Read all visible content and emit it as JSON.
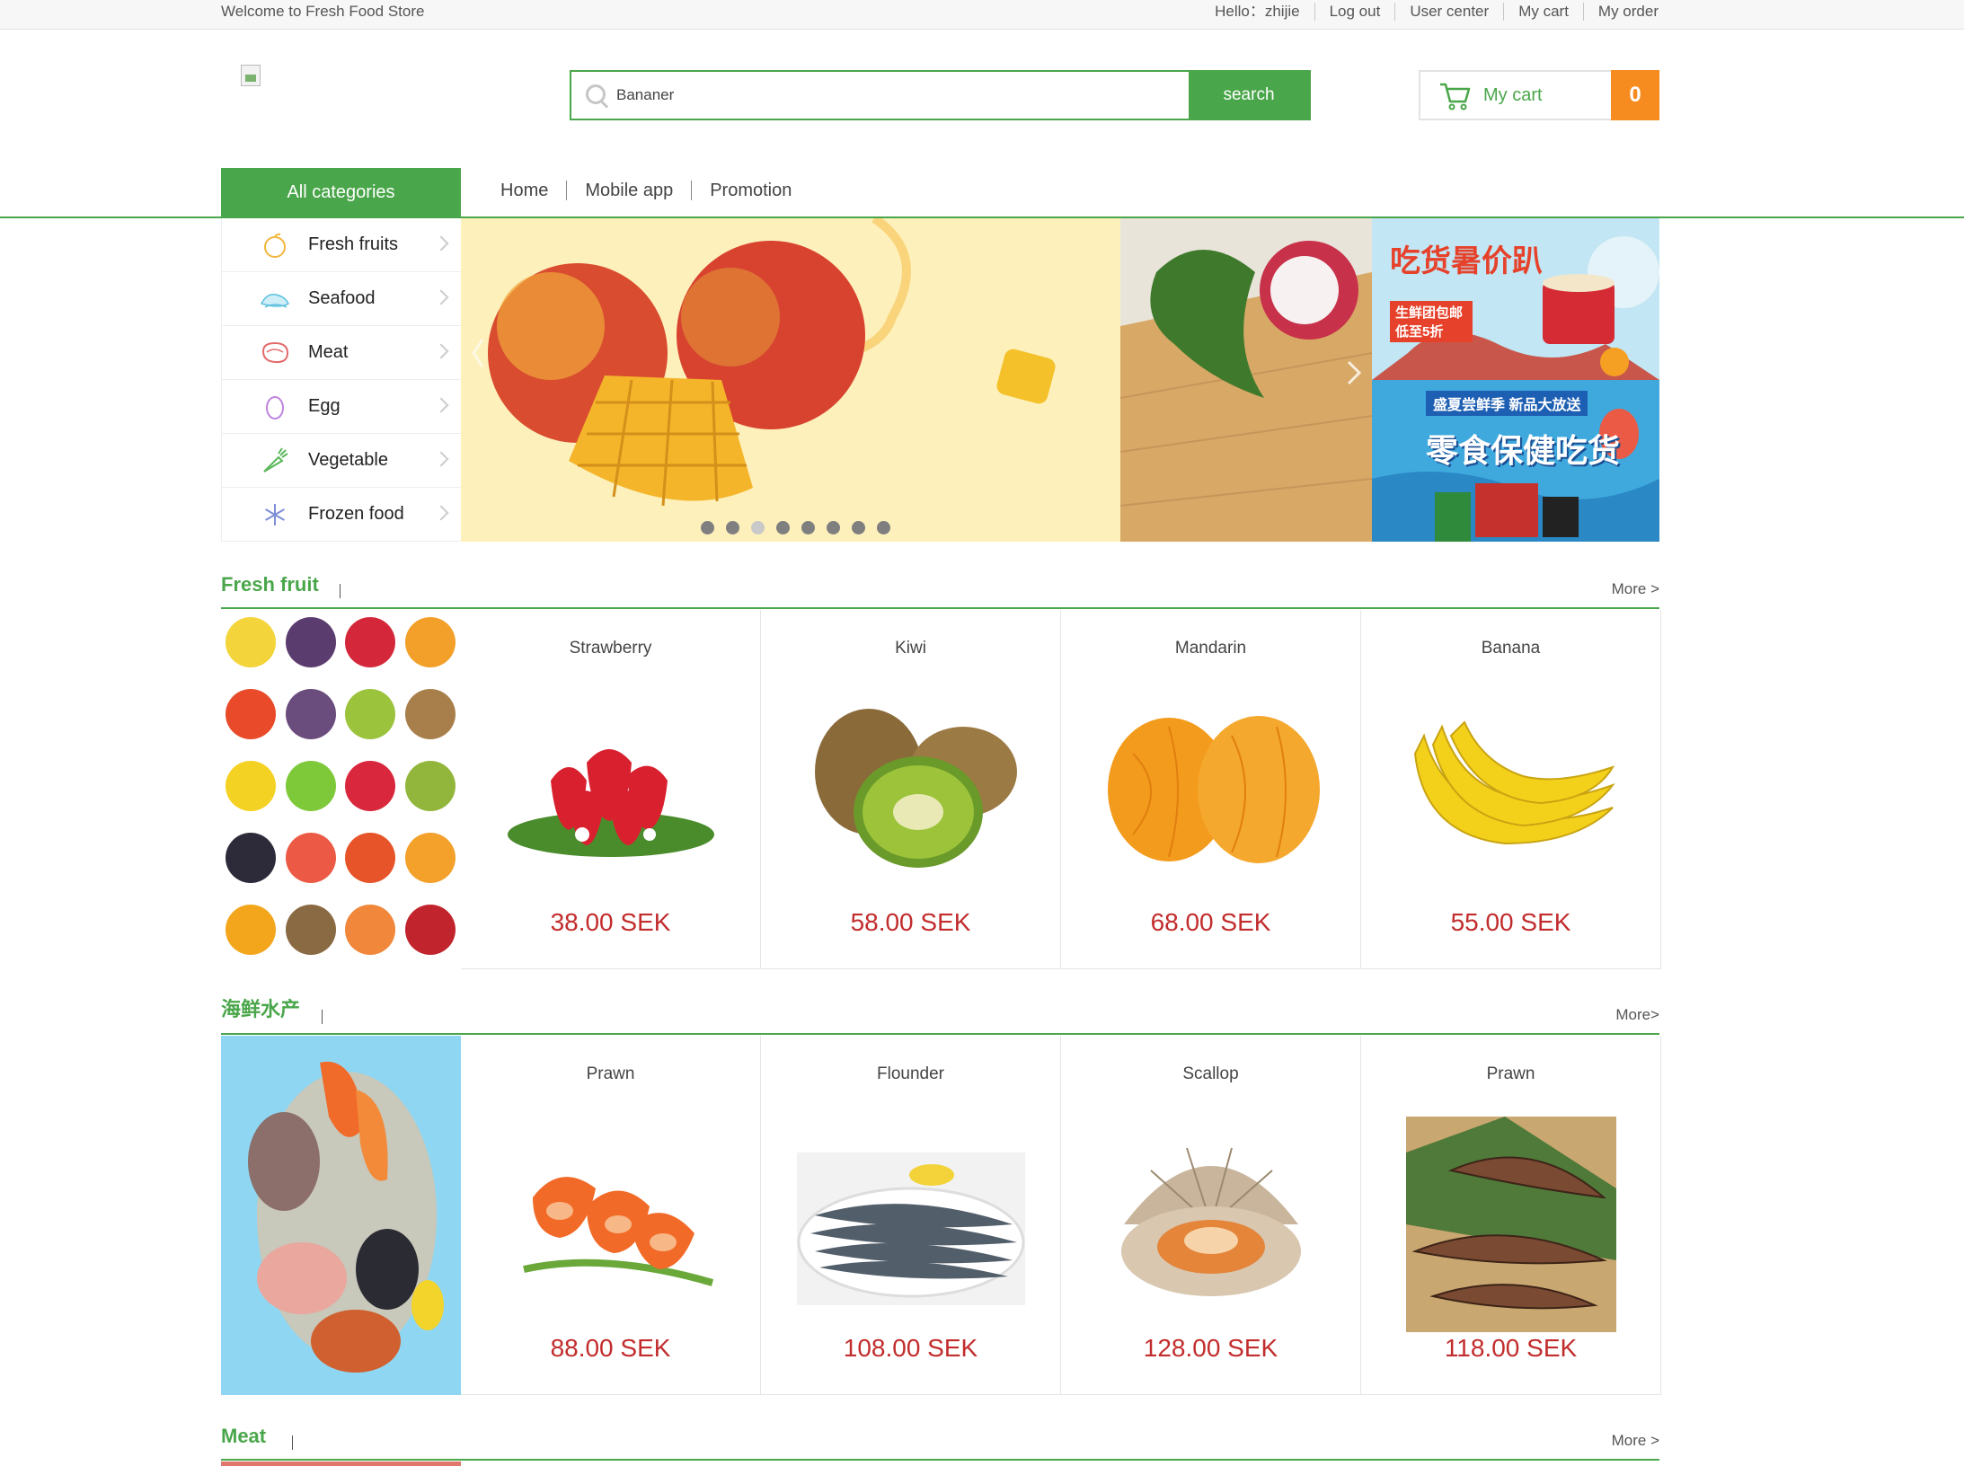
{
  "topbar": {
    "welcome": "Welcome to Fresh Food Store",
    "links": [
      "Hello：zhijie",
      "Log out",
      "User center",
      "My cart",
      "My order"
    ]
  },
  "search": {
    "value": "Bananer",
    "button": "search"
  },
  "cart": {
    "label": "My cart",
    "count": "0"
  },
  "nav": {
    "all_categories": "All categories",
    "links": [
      "Home",
      "Mobile app",
      "Promotion"
    ]
  },
  "categories": [
    "Fresh fruits",
    "Seafood",
    "Meat",
    "Egg",
    "Vegetable",
    "Frozen food"
  ],
  "banner": {
    "slide_count": 8,
    "active_slide": 3
  },
  "ads": {
    "ad1_text": "吃货暑价趴",
    "ad1_sub": "生鲜团包邮 低至5折",
    "ad2_text": "零食保健吃货",
    "ad2_sub": "盛夏尝鲜季 新品大放送"
  },
  "sections": [
    {
      "title": "Fresh fruit",
      "more": "More >",
      "products": [
        {
          "name": "Strawberry",
          "price": "38.00 SEK"
        },
        {
          "name": "Kiwi",
          "price": "58.00 SEK"
        },
        {
          "name": "Mandarin",
          "price": "68.00 SEK"
        },
        {
          "name": "Banana",
          "price": "55.00 SEK"
        }
      ]
    },
    {
      "title": "海鲜水产",
      "more": "More>",
      "products": [
        {
          "name": "Prawn",
          "price": "88.00 SEK"
        },
        {
          "name": "Flounder",
          "price": "108.00 SEK"
        },
        {
          "name": "Scallop",
          "price": "128.00 SEK"
        },
        {
          "name": "Prawn",
          "price": "118.00 SEK"
        }
      ]
    },
    {
      "title": "Meat",
      "more": "More >",
      "products": []
    }
  ],
  "colors": {
    "accent": "#4aa64a",
    "price": "#c22c2c",
    "cart_badge": "#f68b1f"
  }
}
